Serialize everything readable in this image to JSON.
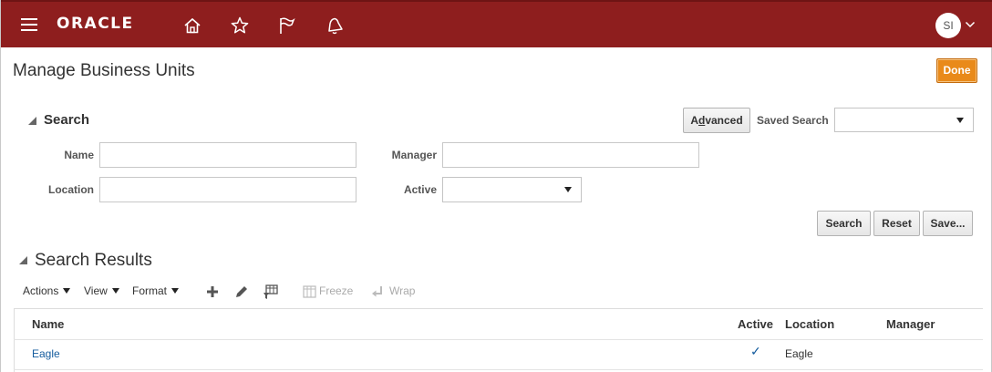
{
  "header": {
    "brand": "ORACLE",
    "user_initials": "SI",
    "icons": [
      "home-icon",
      "star-icon",
      "flag-icon",
      "bell-icon"
    ]
  },
  "page": {
    "title": "Manage Business Units",
    "done_label": "Done"
  },
  "search": {
    "heading": "Search",
    "advanced_label": "Advanced",
    "saved_search_label": "Saved Search",
    "saved_search_value": "",
    "fields": {
      "name_label": "Name",
      "name_value": "",
      "manager_label": "Manager",
      "manager_value": "",
      "location_label": "Location",
      "location_value": "",
      "active_label": "Active",
      "active_value": ""
    },
    "buttons": {
      "search": "Search",
      "reset": "Reset",
      "save": "Save..."
    }
  },
  "results": {
    "heading": "Search Results",
    "toolbar": {
      "actions": "Actions",
      "view": "View",
      "format": "Format",
      "freeze": "Freeze",
      "wrap": "Wrap"
    },
    "columns": [
      "Name",
      "Active",
      "Location",
      "Manager"
    ],
    "rows": [
      {
        "name": "Eagle",
        "active": true,
        "location": "Eagle",
        "manager": ""
      }
    ]
  },
  "colors": {
    "header_bg": "#8e1e1e",
    "done_bg": "#e98a1a",
    "link": "#145c9e"
  }
}
